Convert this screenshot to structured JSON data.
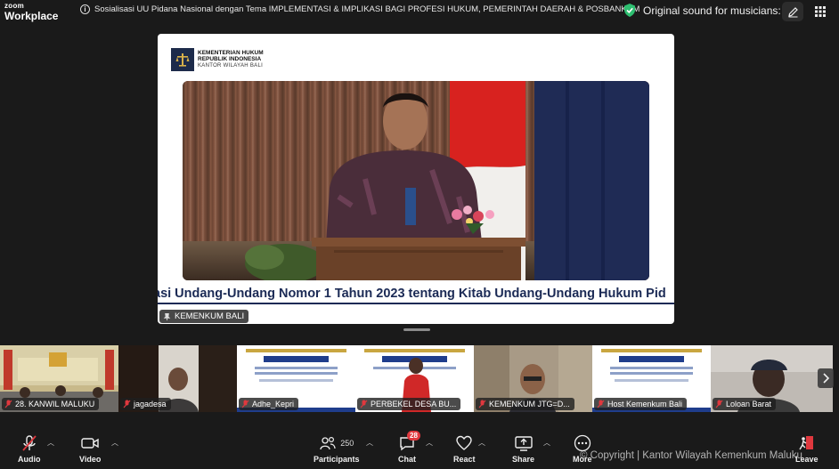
{
  "app": {
    "brand_line1": "zoom",
    "brand_line2": "Workplace"
  },
  "meeting": {
    "title": "Sosialisasi UU Pidana Nasional dengan Tema IMPLEMENTASI & IMPLIKASI BAGI PROFESI HUKUM, PEMERINTAH DAERAH & POSBANKUM"
  },
  "audio_status": {
    "text": "Original sound for musicians: on"
  },
  "share": {
    "logo_line1": "KEMENTERIAN HUKUM",
    "logo_line2": "REPUBLIK INDONESIA",
    "logo_line3": "KANTOR WILAYAH BALI",
    "ticker": "asi Undang-Undang Nomor 1 Tahun 2023 tentang Kitab Undang-Undang Hukum Pid",
    "presenter": "KEMENKUM BALI"
  },
  "gallery": [
    {
      "name": "28. KANWIL MALUKU",
      "muted": true
    },
    {
      "name": "jagadesa",
      "muted": true
    },
    {
      "name": "Adhe_Kepri",
      "muted": true
    },
    {
      "name": "PERBEKEL DESA BU...",
      "muted": true
    },
    {
      "name": "KEMENKUM JTG=D...",
      "muted": true
    },
    {
      "name": "Host Kemenkum Bali",
      "muted": true
    },
    {
      "name": "Loloan Barat",
      "muted": true
    }
  ],
  "toolbar": {
    "audio": "Audio",
    "video": "Video",
    "participants": "Participants",
    "participants_count": "250",
    "chat": "Chat",
    "chat_badge": "28",
    "react": "React",
    "share": "Share",
    "more": "More",
    "leave": "Leave"
  },
  "watermark": "© Copyright | Kantor Wilayah Kemenkum Maluku",
  "colors": {
    "leave": "#e0383e",
    "ticker": "#1b2a55",
    "shield": "#2fbf71"
  }
}
